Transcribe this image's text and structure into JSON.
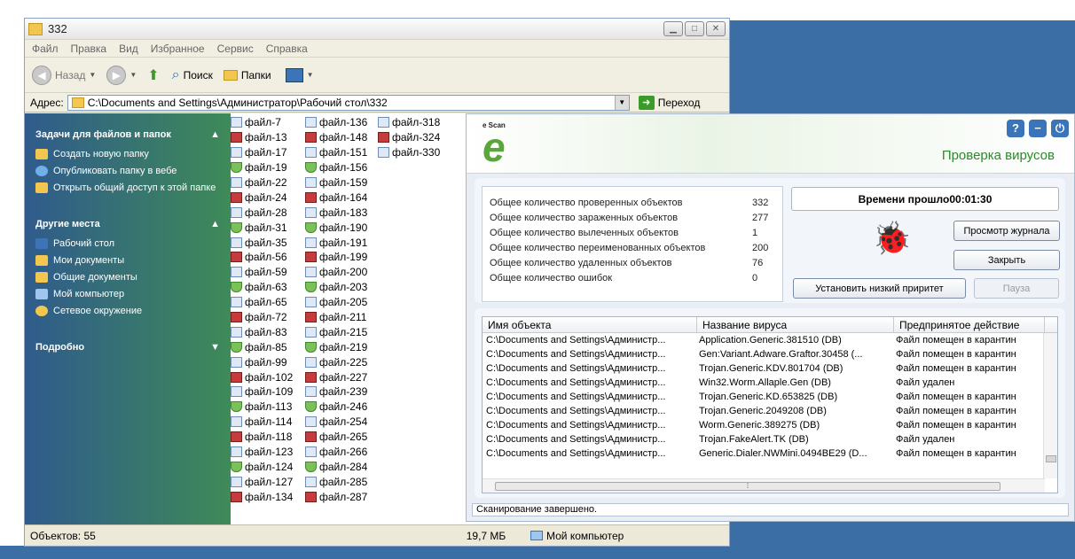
{
  "explorer": {
    "title": "332",
    "menu": [
      "Файл",
      "Правка",
      "Вид",
      "Избранное",
      "Сервис",
      "Справка"
    ],
    "toolbar": {
      "back": "Назад",
      "search": "Поиск",
      "folders": "Папки"
    },
    "address": {
      "label": "Адрес:",
      "value": "C:\\Documents and Settings\\Администратор\\Рабочий стол\\332",
      "go": "Переход"
    },
    "sidebar": {
      "tasks_title": "Задачи для файлов и папок",
      "tasks": [
        "Создать новую папку",
        "Опубликовать папку в вебе",
        "Открыть общий доступ к этой папке"
      ],
      "places_title": "Другие места",
      "places": [
        "Рабочий стол",
        "Мои документы",
        "Общие документы",
        "Мой компьютер",
        "Сетевое окружение"
      ],
      "details_title": "Подробно"
    },
    "files": {
      "col1": [
        "файл-7",
        "файл-13",
        "файл-17",
        "файл-19",
        "файл-22",
        "файл-24",
        "файл-28",
        "файл-31",
        "файл-35",
        "файл-56",
        "файл-59",
        "файл-63",
        "файл-65",
        "файл-72",
        "файл-83",
        "файл-85",
        "файл-99",
        "файл-102",
        "файл-109",
        "файл-113",
        "файл-114",
        "файл-118",
        "файл-123",
        "файл-124",
        "файл-127",
        "файл-134"
      ],
      "col2": [
        "файл-136",
        "файл-148",
        "файл-151",
        "файл-156",
        "файл-159",
        "файл-164",
        "файл-183",
        "файл-190",
        "файл-191",
        "файл-199",
        "файл-200",
        "файл-203",
        "файл-205",
        "файл-211",
        "файл-215",
        "файл-219",
        "файл-225",
        "файл-227",
        "файл-239",
        "файл-246",
        "файл-254",
        "файл-265",
        "файл-266",
        "файл-284",
        "файл-285",
        "файл-287"
      ],
      "col3": [
        "файл-318",
        "файл-324",
        "файл-330"
      ]
    },
    "status": {
      "objects": "Объектов: 55",
      "size": "19,7 МБ",
      "location": "Мой компьютер"
    }
  },
  "escan": {
    "brand": "e Scan",
    "title": "Проверка вирусов",
    "stats": [
      {
        "label": "Общее количество проверенных объектов",
        "value": "332"
      },
      {
        "label": "Общее количество зараженных объектов",
        "value": "277"
      },
      {
        "label": "Общее количество вылеченных объектов",
        "value": "1"
      },
      {
        "label": "Общее количество переименованных объектов",
        "value": "200"
      },
      {
        "label": "Общее количество удаленных объектов",
        "value": "76"
      },
      {
        "label": "Общее количество ошибок",
        "value": "0"
      }
    ],
    "elapsed_label": "Времени прошло",
    "elapsed_value": "00:01:30",
    "buttons": {
      "log": "Просмотр журнала",
      "close": "Закрыть",
      "low_priority": "Установить низкий приритет",
      "pause": "Пауза"
    },
    "table": {
      "headers": [
        "Имя объекта",
        "Название вируса",
        "Предпринятое действие"
      ],
      "rows": [
        [
          "C:\\Documents and Settings\\Администр...",
          "Application.Generic.381510 (DB)",
          "Файл помещен в карантин"
        ],
        [
          "C:\\Documents and Settings\\Администр...",
          "Gen:Variant.Adware.Graftor.30458 (...",
          "Файл помещен в карантин"
        ],
        [
          "C:\\Documents and Settings\\Администр...",
          "Trojan.Generic.KDV.801704 (DB)",
          "Файл помещен в карантин"
        ],
        [
          "C:\\Documents and Settings\\Администр...",
          "Win32.Worm.Allaple.Gen (DB)",
          "Файл удален"
        ],
        [
          "C:\\Documents and Settings\\Администр...",
          "Trojan.Generic.KD.653825 (DB)",
          "Файл помещен в карантин"
        ],
        [
          "C:\\Documents and Settings\\Администр...",
          "Trojan.Generic.2049208 (DB)",
          "Файл помещен в карантин"
        ],
        [
          "C:\\Documents and Settings\\Администр...",
          "Worm.Generic.389275 (DB)",
          "Файл помещен в карантин"
        ],
        [
          "C:\\Documents and Settings\\Администр...",
          "Trojan.FakeAlert.TK (DB)",
          "Файл удален"
        ],
        [
          "C:\\Documents and Settings\\Администр...",
          "Generic.Dialer.NWMini.0494BE29 (D...",
          "Файл помещен в карантин"
        ]
      ]
    },
    "status": "Сканирование завершено."
  }
}
